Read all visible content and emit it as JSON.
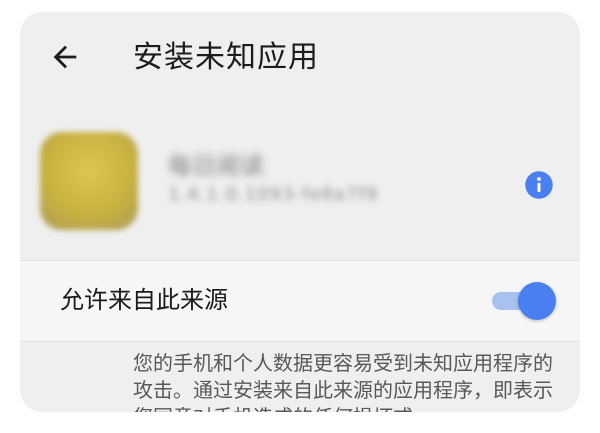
{
  "header": {
    "back_icon": "arrow-back-icon",
    "title": "安装未知应用"
  },
  "app": {
    "name": "每日阅读",
    "version": "1.4.1.0.1093-fe8a7f9",
    "info_icon": "info-icon",
    "accent_color": "#4a7ff2"
  },
  "setting": {
    "label": "允许来自此来源",
    "enabled": true
  },
  "warning": {
    "text": "您的手机和个人数据更容易受到未知应用程序的攻击。通过安装来自此来源的应用程序，即表示您同意对手机造成的任何损坏或"
  }
}
